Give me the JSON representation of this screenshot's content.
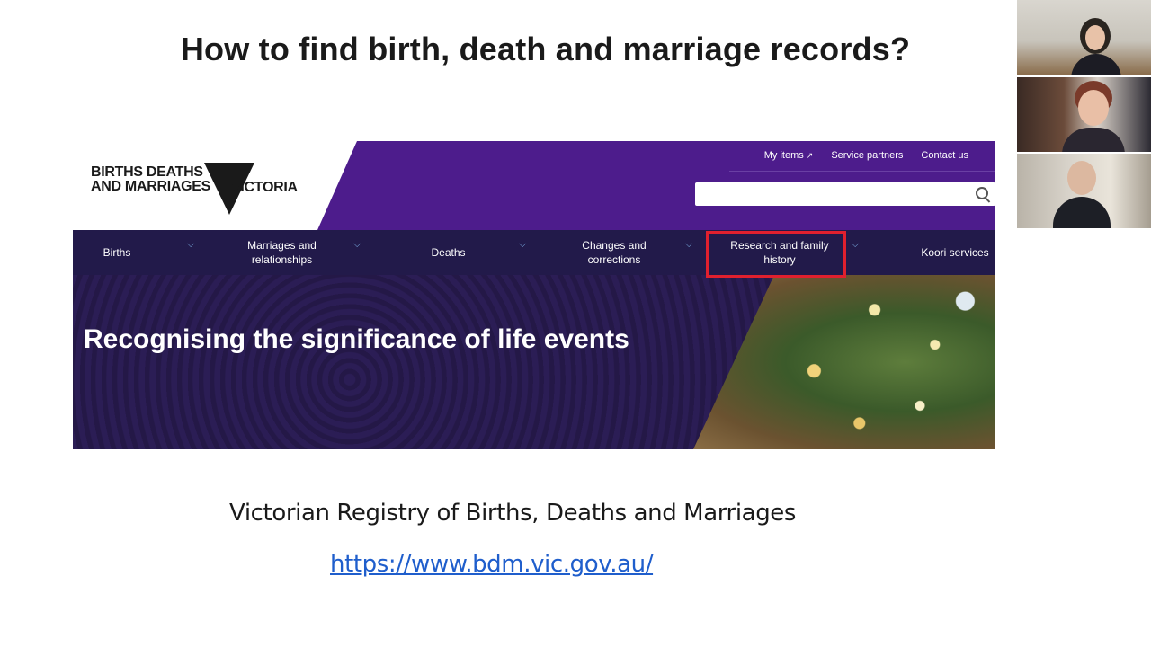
{
  "slide": {
    "title": "How to find birth, death and marriage records?",
    "caption": "Victorian Registry of Births, Deaths and Marriages",
    "link": "https://www.bdm.vic.gov.au/"
  },
  "website": {
    "logo": {
      "line1": "BIRTHS DEATHS",
      "line2": "AND MARRIAGES",
      "victoria": "VICTORIA"
    },
    "utility_links": [
      "My items",
      "Service partners",
      "Contact us"
    ],
    "search": {
      "placeholder": ""
    },
    "nav": [
      "Births",
      "Marriages and relationships",
      "Deaths",
      "Changes and corrections",
      "Research and family history",
      "Koori services"
    ],
    "highlighted_nav": "Research and family history",
    "hero_heading": "Recognising the significance of life events",
    "colors": {
      "header_purple": "#4d1c8c",
      "nav_background": "#221a4a",
      "highlight": "#e0202e",
      "link": "#1f5ecc"
    }
  },
  "participants": [
    {
      "icon": "participant-video-icon"
    },
    {
      "icon": "participant-video-icon"
    },
    {
      "icon": "participant-video-icon"
    }
  ]
}
